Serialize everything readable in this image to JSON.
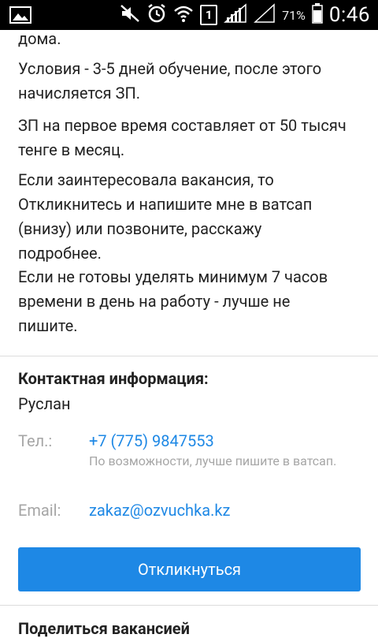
{
  "status_bar": {
    "battery_percent": "71%",
    "time": "0:46",
    "sim_slot": "1"
  },
  "description": {
    "line_top_cut": "дома.",
    "para1": "Условия - 3-5 дней обучение, после этого начисляется ЗП.",
    "para2": "ЗП на первое время составляет от 50 тысяч тенге в месяц.",
    "para3a": "Если заинтересовала вакансия, то Откликнитесь и напишите мне в ватсап (внизу) или позвоните, расскажу подробнее.",
    "para3b": "Если не готовы уделять минимум 7 часов времени в день на работу - лучше не пишите."
  },
  "contact": {
    "heading": "Контактная информация:",
    "name": "Руслан",
    "phone_label": "Тел.:",
    "phone": "+7 (775) 9847553",
    "phone_note": "По возможности, лучше пишите в ватсап.",
    "email_label": "Email:",
    "email": "zakaz@ozvuchka.kz"
  },
  "respond_button": "Откликнуться",
  "share_heading": "Поделиться вакансией",
  "colors": {
    "accent": "#1e88e5",
    "muted": "#a6a6a6",
    "text": "#222222"
  }
}
